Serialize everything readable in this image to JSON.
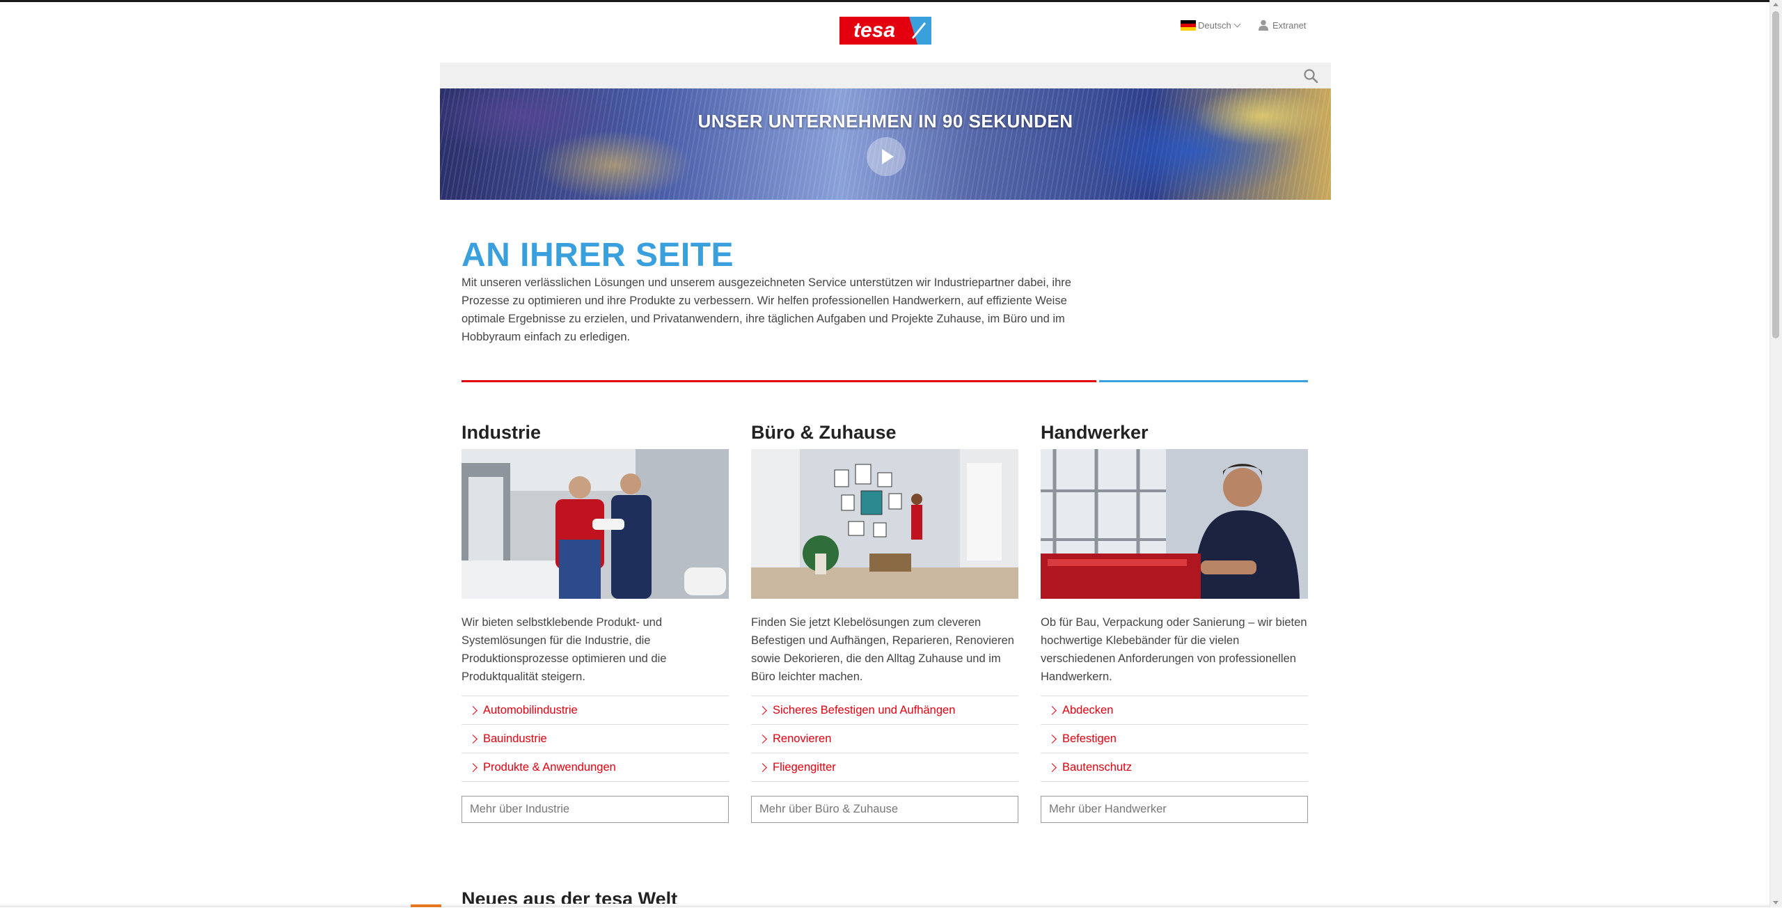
{
  "header": {
    "logo_text": "tesa",
    "language": "Deutsch",
    "extranet_label": "Extranet"
  },
  "search": {
    "placeholder": "",
    "value": ""
  },
  "hero": {
    "title": "UNSER UNTERNEHMEN IN 90 SEKUNDEN"
  },
  "intro": {
    "title": "AN IHRER SEITE",
    "text": "Mit unseren verlässlichen Lösungen und unserem ausgezeichneten Service unterstützen wir Industriepartner dabei, ihre Prozesse zu optimieren und ihre Produkte zu verbessern. Wir helfen professionellen Handwerkern, auf effiziente Weise optimale Ergebnisse zu erzielen, und Privatanwendern, ihre täglichen Aufgaben und Projekte Zuhause, im Büro und im Hobbyraum einfach zu erledigen."
  },
  "columns": [
    {
      "title": "Industrie",
      "text": "Wir bieten selbstklebende Produkt- und Systemlösungen für die Industrie, die Produktionsprozesse optimieren und die Produktqualität steigern.",
      "links": [
        "Automobilindustrie",
        "Bauindustrie",
        "Produkte & Anwendungen"
      ],
      "more": "Mehr über Industrie"
    },
    {
      "title": "Büro & Zuhause",
      "text": "Finden Sie jetzt Klebelösungen zum cleveren Befestigen und Aufhängen, Reparieren, Renovieren sowie Dekorieren, die den Alltag Zuhause und im Büro leichter machen.",
      "links": [
        "Sicheres Befestigen und Aufhängen",
        "Renovieren",
        "Fliegengitter"
      ],
      "more": "Mehr über Büro & Zuhause"
    },
    {
      "title": "Handwerker",
      "text": "Ob für Bau, Verpackung oder Sanierung – wir bieten hochwertige Klebebänder für die vielen verschiedenen Anforderungen von professionellen Handwerkern.",
      "links": [
        "Abdecken",
        "Befestigen",
        "Bautenschutz"
      ],
      "more": "Mehr über Handwerker"
    }
  ],
  "news": {
    "title": "Neues aus der tesa Welt"
  },
  "colors": {
    "brand_red": "#e3000f",
    "brand_blue": "#3aa0dd"
  }
}
